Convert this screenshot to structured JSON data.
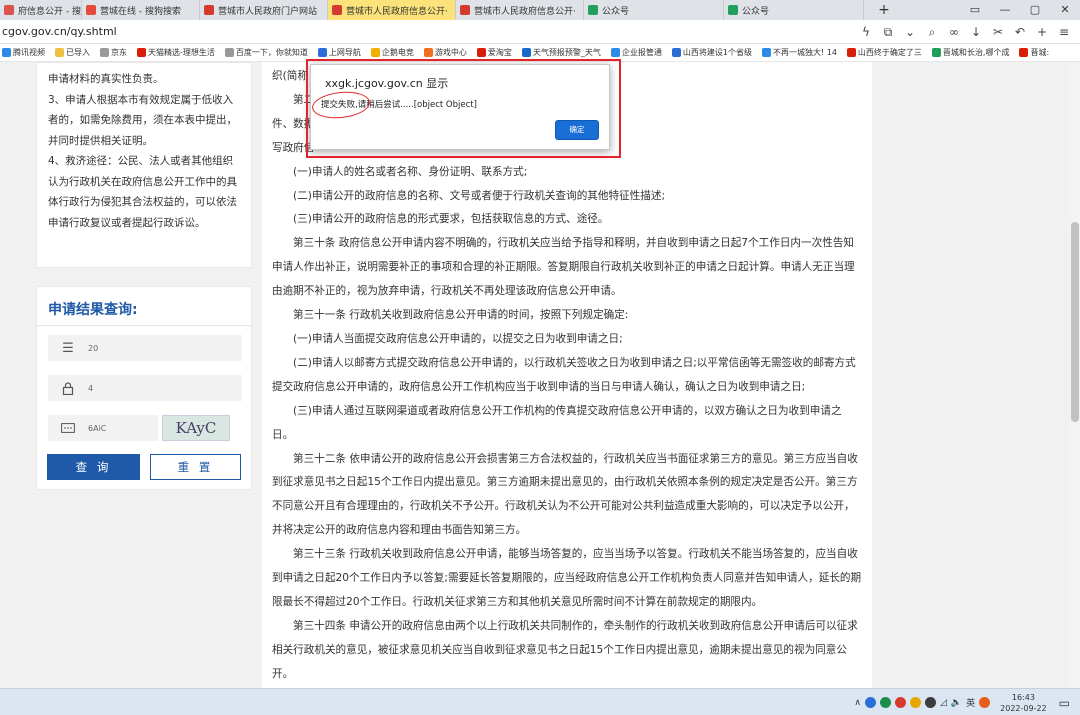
{
  "browser": {
    "tabs": [
      {
        "label": "府信息公开 - 搜狗搜索",
        "icon_color": "#d9534f",
        "active": false
      },
      {
        "label": "营城在线 - 搜狗搜索",
        "icon_color": "#e24a3b",
        "active": false
      },
      {
        "label": "营城市人民政府门户网站",
        "icon_color": "#d43b2f",
        "active": false
      },
      {
        "label": "营城市人民政府信息公开·",
        "icon_color": "#d43b2f",
        "active": true
      },
      {
        "label": "营城市人民政府信息公开·",
        "icon_color": "#d43b2f",
        "active": false
      },
      {
        "label": "公众号",
        "icon_color": "#20a05a",
        "active": false
      },
      {
        "label": "公众号",
        "icon_color": "#20a05a",
        "active": false
      }
    ],
    "tab_close_glyph": "×",
    "new_tab_glyph": "+",
    "window_controls": [
      "▭",
      "—",
      "▢",
      "✕"
    ],
    "url": "cgov.gov.cn/qy.shtml",
    "bookmarks": [
      {
        "label": "腾讯视频",
        "color": "#2b8be6"
      },
      {
        "label": "已导入",
        "color": "#f0c040"
      },
      {
        "label": "京东",
        "color": "#999"
      },
      {
        "label": "天猫精选-理想生活",
        "color": "#d81e06"
      },
      {
        "label": "百度一下，你就知道",
        "color": "#999"
      },
      {
        "label": "上网导航",
        "color": "#2b6fd6"
      },
      {
        "label": "企鹅电竞",
        "color": "#f0b000"
      },
      {
        "label": "游戏中心",
        "color": "#f07020"
      },
      {
        "label": "爱淘宝",
        "color": "#d81e06"
      },
      {
        "label": "天气预报预警_天气",
        "color": "#1b6ac9"
      },
      {
        "label": "企业报管通",
        "color": "#2b8be6"
      },
      {
        "label": "山西将建设1个省级",
        "color": "#2b6fd6"
      },
      {
        "label": "不再一城独大! 14",
        "color": "#2b8be6"
      },
      {
        "label": "山西终于确定了三",
        "color": "#d81e06"
      },
      {
        "label": "晋城和长治,哪个成",
        "color": "#20a05a"
      },
      {
        "label": "晋城:",
        "color": "#d81e06"
      }
    ]
  },
  "left_panel": {
    "notes": [
      "申请材料的真实性负责。",
      "3、申请人根据本市有效规定属于低收入者的，如需免除费用，须在本表中提出，并同时提供相关证明。",
      "4、救济途径：公民、法人或者其他组织认为行政机关在政府信息公开工作中的具体行政行为侵犯其合法权益的，可以依法申请行政复议或者提起行政诉讼。"
    ]
  },
  "query": {
    "title": "申请结果查询:",
    "fields": [
      {
        "icon": "list-icon",
        "value": "20"
      },
      {
        "icon": "lock-icon",
        "value": "4"
      },
      {
        "icon": "captcha-icon",
        "value": "6AiC"
      }
    ],
    "captcha_text": "KAyC",
    "submit_label": "查 询",
    "reset_label": "重 置"
  },
  "content": {
    "paragraphs": [
      {
        "text": "织(简称",
        "indent": false
      },
      {
        "text": "第二 行政机关的政府信息公开工作机构提出，并采用包括信",
        "indent": true
      },
      {
        "text": "件、数据 提出，由受理该申请的政府信息公开工作机构代为填",
        "indent": false
      },
      {
        "text": "写政府信",
        "indent": false
      },
      {
        "text": "(一)申请人的姓名或者名称、身份证明、联系方式;",
        "indent": true
      },
      {
        "text": "(二)申请公开的政府信息的名称、文号或者便于行政机关查询的其他特征性描述;",
        "indent": true
      },
      {
        "text": "(三)申请公开的政府信息的形式要求，包括获取信息的方式、途径。",
        "indent": true
      },
      {
        "text": "第三十条 政府信息公开申请内容不明确的，行政机关应当给予指导和释明，并自收到申请之日起7个工作日内一次性告知申请人作出补正，说明需要补正的事项和合理的补正期限。答复期限自行政机关收到补正的申请之日起计算。申请人无正当理由逾期不补正的，视为放弃申请，行政机关不再处理该政府信息公开申请。",
        "indent": true
      },
      {
        "text": "第三十一条 行政机关收到政府信息公开申请的时间，按照下列规定确定:",
        "indent": true
      },
      {
        "text": "(一)申请人当面提交政府信息公开申请的，以提交之日为收到申请之日;",
        "indent": true
      },
      {
        "text": "(二)申请人以邮寄方式提交政府信息公开申请的，以行政机关签收之日为收到申请之日;以平常信函等无需签收的邮寄方式提交政府信息公开申请的，政府信息公开工作机构应当于收到申请的当日与申请人确认，确认之日为收到申请之日;",
        "indent": true
      },
      {
        "text": "(三)申请人通过互联网渠道或者政府信息公开工作机构的传真提交政府信息公开申请的，以双方确认之日为收到申请之日。",
        "indent": true
      },
      {
        "text": "第三十二条 依申请公开的政府信息公开会损害第三方合法权益的，行政机关应当书面征求第三方的意见。第三方应当自收到征求意见书之日起15个工作日内提出意见。第三方逾期未提出意见的，由行政机关依照本条例的规定决定是否公开。第三方不同意公开且有合理理由的，行政机关不予公开。行政机关认为不公开可能对公共利益造成重大影响的，可以决定予以公开，并将决定公开的政府信息内容和理由书面告知第三方。",
        "indent": true
      },
      {
        "text": "第三十三条 行政机关收到政府信息公开申请，能够当场答复的，应当当场予以答复。行政机关不能当场答复的，应当自收到申请之日起20个工作日内予以答复;需要延长答复期限的，应当经政府信息公开工作机构负责人同意并告知申请人，延长的期限最长不得超过20个工作日。行政机关征求第三方和其他机关意见所需时间不计算在前款规定的期限内。",
        "indent": true
      },
      {
        "text": "第三十四条 申请公开的政府信息由两个以上行政机关共同制作的，牵头制作的行政机关收到政府信息公开申请后可以征求相关行政机关的意见，被征求意见机关应当自收到征求意见书之日起15个工作日内提出意见，逾期未提出意见的视为同意公开。",
        "indent": true
      }
    ]
  },
  "dialog": {
    "title": "xxgk.jcgov.gov.cn 显示",
    "message": "提交失败,请稍后尝试.....[object Object]",
    "ok_label": "确定"
  },
  "taskbar": {
    "time": "16:43",
    "date": "2022-09-22"
  },
  "colors": {
    "accent": "#1f5aa8",
    "highlight": "#e3262c",
    "dialog_button": "#1a6fd6"
  }
}
